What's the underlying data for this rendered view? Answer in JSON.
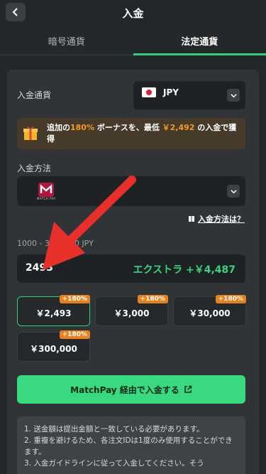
{
  "header": {
    "title": "入金"
  },
  "tabs": [
    {
      "label": "暗号通貨",
      "active": false
    },
    {
      "label": "法定通貨",
      "active": true
    }
  ],
  "currency": {
    "label": "入金通貨",
    "code": "JPY",
    "flag": "japan-flag-icon"
  },
  "bonus": {
    "pre": "追加の",
    "percent": "180%",
    "mid": " ボーナスを、最低 ",
    "min": "￥2,492",
    "post": " の入金で獲得"
  },
  "method": {
    "label": "入金方法",
    "logo_text": "MATCH PAY",
    "help": "入金方法は？"
  },
  "range": "1000 - 3000000 JPY",
  "amount": {
    "value": "2493",
    "extra": "エクストラ +￥4,487"
  },
  "chips": [
    {
      "amount": "￥2,493",
      "badge": "+180%",
      "selected": true
    },
    {
      "amount": "￥3,000",
      "badge": "+180%",
      "selected": false
    },
    {
      "amount": "￥30,000",
      "badge": "+180%",
      "selected": false
    },
    {
      "amount": "￥300,000",
      "badge": "+180%",
      "selected": false
    }
  ],
  "deposit_button": "MatchPay 経由で入金する",
  "notes": [
    "1. 送金額は提出金額と一致している必要があります。",
    "2. 重複を避けるため、各注文IDは1度のみ使用することができます。",
    "3. 入金ガイドラインに従って入金してください。そう"
  ],
  "colors": {
    "accent": "#31d07a",
    "bonus": "#f59a23",
    "badge": "#e8821f",
    "arrow": "#e8302b"
  }
}
